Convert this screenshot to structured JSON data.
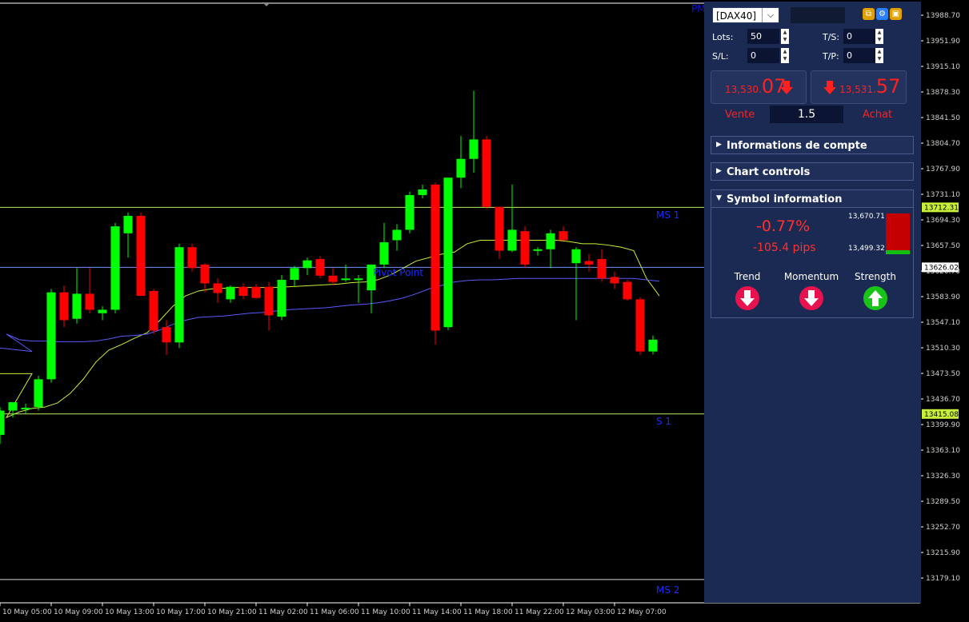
{
  "chart": {
    "pm_label": "PM",
    "level_labels": {
      "ms1": "MS 1",
      "pivot": "Pivot Point",
      "s1": "S 1",
      "ms2": "MS 2"
    },
    "price_axis": [
      "13988.70",
      "13951.90",
      "13915.10",
      "13878.30",
      "13841.50",
      "13804.70",
      "13767.90",
      "13731.10",
      "13694.30",
      "13657.50",
      "13620.70",
      "13583.90",
      "13547.10",
      "13510.30",
      "13473.50",
      "13436.70",
      "13399.90",
      "13363.10",
      "13326.30",
      "13289.50",
      "13252.70",
      "13215.90",
      "13179.10"
    ],
    "price_tags": [
      {
        "value": "13712.31"
      },
      {
        "value": "13626.02"
      },
      {
        "value": "13415.08"
      }
    ],
    "time_axis": [
      "10 May 05:00",
      "10 May 09:00",
      "10 May 13:00",
      "10 May 17:00",
      "10 May 21:00",
      "11 May 02:00",
      "11 May 06:00",
      "11 May 10:00",
      "11 May 14:00",
      "11 May 18:00",
      "11 May 22:00",
      "12 May 03:00",
      "12 May 07:00"
    ]
  },
  "chart_data": {
    "type": "candlestick",
    "y_range": [
      13160,
      14000
    ],
    "levels": {
      "MS 1": 13712.31,
      "Pivot Point": 13626.02,
      "S 1": 13415.08,
      "MS 2": 13177
    },
    "candles": [
      {
        "o": 13385,
        "h": 13425,
        "l": 13372,
        "c": 13420
      },
      {
        "o": 13420,
        "h": 13425,
        "l": 13410,
        "c": 13432
      },
      {
        "o": 13422,
        "h": 13430,
        "l": 13416,
        "c": 13424
      },
      {
        "o": 13425,
        "h": 13470,
        "l": 13420,
        "c": 13465
      },
      {
        "o": 13465,
        "h": 13595,
        "l": 13460,
        "c": 13590
      },
      {
        "o": 13590,
        "h": 13600,
        "l": 13540,
        "c": 13550
      },
      {
        "o": 13552,
        "h": 13625,
        "l": 13545,
        "c": 13588
      },
      {
        "o": 13588,
        "h": 13625,
        "l": 13560,
        "c": 13565
      },
      {
        "o": 13560,
        "h": 13570,
        "l": 13550,
        "c": 13565
      },
      {
        "o": 13565,
        "h": 13690,
        "l": 13560,
        "c": 13685
      },
      {
        "o": 13675,
        "h": 13705,
        "l": 13640,
        "c": 13700
      },
      {
        "o": 13700,
        "h": 13705,
        "l": 13590,
        "c": 13585
      },
      {
        "o": 13592,
        "h": 13595,
        "l": 13530,
        "c": 13535
      },
      {
        "o": 13540,
        "h": 13550,
        "l": 13500,
        "c": 13518
      },
      {
        "o": 13518,
        "h": 13660,
        "l": 13510,
        "c": 13655
      },
      {
        "o": 13655,
        "h": 13660,
        "l": 13620,
        "c": 13625
      },
      {
        "o": 13630,
        "h": 13632,
        "l": 13590,
        "c": 13603
      },
      {
        "o": 13603,
        "h": 13610,
        "l": 13575,
        "c": 13589
      },
      {
        "o": 13580,
        "h": 13600,
        "l": 13575,
        "c": 13598
      },
      {
        "o": 13598,
        "h": 13603,
        "l": 13580,
        "c": 13585
      },
      {
        "o": 13598,
        "h": 13602,
        "l": 13580,
        "c": 13582
      },
      {
        "o": 13598,
        "h": 13605,
        "l": 13535,
        "c": 13557
      },
      {
        "o": 13555,
        "h": 13615,
        "l": 13550,
        "c": 13608
      },
      {
        "o": 13608,
        "h": 13628,
        "l": 13598,
        "c": 13625
      },
      {
        "o": 13625,
        "h": 13640,
        "l": 13615,
        "c": 13636
      },
      {
        "o": 13638,
        "h": 13642,
        "l": 13610,
        "c": 13614
      },
      {
        "o": 13614,
        "h": 13625,
        "l": 13600,
        "c": 13605
      },
      {
        "o": 13608,
        "h": 13630,
        "l": 13605,
        "c": 13610
      },
      {
        "o": 13608,
        "h": 13615,
        "l": 13575,
        "c": 13610
      },
      {
        "o": 13593,
        "h": 13630,
        "l": 13560,
        "c": 13630
      },
      {
        "o": 13630,
        "h": 13690,
        "l": 13625,
        "c": 13662
      },
      {
        "o": 13665,
        "h": 13688,
        "l": 13650,
        "c": 13680
      },
      {
        "o": 13680,
        "h": 13735,
        "l": 13675,
        "c": 13730
      },
      {
        "o": 13730,
        "h": 13745,
        "l": 13725,
        "c": 13738
      },
      {
        "o": 13745,
        "h": 13748,
        "l": 13515,
        "c": 13535
      },
      {
        "o": 13540,
        "h": 13752,
        "l": 13536,
        "c": 13755
      },
      {
        "o": 13755,
        "h": 13815,
        "l": 13740,
        "c": 13782
      },
      {
        "o": 13782,
        "h": 13880,
        "l": 13762,
        "c": 13810
      },
      {
        "o": 13810,
        "h": 13815,
        "l": 13710,
        "c": 13713
      },
      {
        "o": 13713,
        "h": 13712,
        "l": 13638,
        "c": 13650
      },
      {
        "o": 13650,
        "h": 13745,
        "l": 13648,
        "c": 13680
      },
      {
        "o": 13678,
        "h": 13685,
        "l": 13625,
        "c": 13630
      },
      {
        "o": 13650,
        "h": 13655,
        "l": 13643,
        "c": 13652
      },
      {
        "o": 13652,
        "h": 13680,
        "l": 13625,
        "c": 13675
      },
      {
        "o": 13678,
        "h": 13685,
        "l": 13665,
        "c": 13665
      },
      {
        "o": 13632,
        "h": 13655,
        "l": 13550,
        "c": 13652
      },
      {
        "o": 13635,
        "h": 13645,
        "l": 13620,
        "c": 13630
      },
      {
        "o": 13638,
        "h": 13652,
        "l": 13605,
        "c": 13610
      },
      {
        "o": 13612,
        "h": 13620,
        "l": 13595,
        "c": 13603
      },
      {
        "o": 13605,
        "h": 13608,
        "l": 13578,
        "c": 13580
      },
      {
        "o": 13580,
        "h": 13583,
        "l": 13500,
        "c": 13505
      },
      {
        "o": 13505,
        "h": 13528,
        "l": 13501,
        "c": 13522
      }
    ],
    "ma_fast": [
      13410,
      13418,
      13423,
      13425,
      13431,
      13445,
      13465,
      13490,
      13507,
      13515,
      13524,
      13532,
      13550,
      13570,
      13585,
      13592,
      13595,
      13596,
      13597,
      13597,
      13597,
      13597,
      13598,
      13599,
      13600,
      13601,
      13602,
      13604,
      13605,
      13608,
      13615,
      13625,
      13635,
      13640,
      13645,
      13648,
      13660,
      13665,
      13665,
      13665,
      13665,
      13665,
      13665,
      13665,
      13663,
      13660,
      13660,
      13658,
      13655,
      13650,
      13610,
      13585
    ],
    "ma_slow": [
      13530,
      13522,
      13520,
      13520,
      13519,
      13519,
      13519,
      13520,
      13523,
      13527,
      13528,
      13530,
      13536,
      13544,
      13550,
      13554,
      13555,
      13556,
      13558,
      13560,
      13561,
      13563,
      13565,
      13566,
      13567,
      13568,
      13570,
      13572,
      13573,
      13575,
      13578,
      13582,
      13588,
      13595,
      13600,
      13605,
      13607,
      13608,
      13608,
      13609,
      13610,
      13610,
      13610,
      13610,
      13610,
      13610,
      13610,
      13610,
      13610,
      13610,
      13608,
      13606
    ]
  },
  "panel": {
    "symbol": "[DAX40]",
    "lots_label": "Lots:",
    "lots_value": "50",
    "sl_label": "S/L:",
    "sl_value": "0",
    "ts_label": "T/S:",
    "ts_value": "0",
    "tp_label": "T/P:",
    "tp_value": "0",
    "sell": {
      "small": "13,530.",
      "big": "07",
      "label": "Vente"
    },
    "buy": {
      "small": "13,531.",
      "big": "57",
      "label": "Achat"
    },
    "spread": "1.5",
    "sections": [
      "Informations de compte",
      "Chart controls",
      "Symbol information"
    ],
    "symbol_info": {
      "change_pct": "-0.77%",
      "change_pips": "-105.4 pips",
      "high": "13,670.71",
      "low": "13,499.32",
      "range_red_fraction": 0.9,
      "indicators": [
        {
          "label": "Trend",
          "direction": "down"
        },
        {
          "label": "Momentum",
          "direction": "down"
        },
        {
          "label": "Strength",
          "direction": "up"
        }
      ]
    },
    "colors": {
      "bull": "#00ff00",
      "bear": "#ff0000",
      "panel": "#1b2a52",
      "down_btn": "#e8124f",
      "up_btn": "#18c418"
    }
  }
}
